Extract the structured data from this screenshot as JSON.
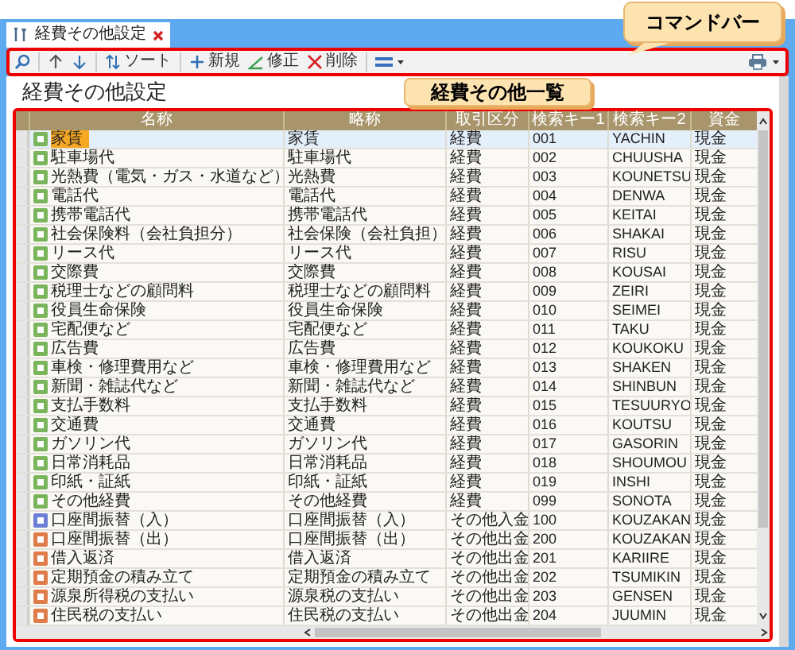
{
  "tab": {
    "title": "経費その他設定"
  },
  "toolbar": {
    "sort": "ソート",
    "new": "新規",
    "edit": "修正",
    "delete": "削除"
  },
  "page_title": "経費その他設定",
  "callouts": [
    {
      "text": "コマンドバー"
    },
    {
      "text": "経費その他一覧"
    }
  ],
  "table": {
    "columns": [
      "名称",
      "略称",
      "取引区分",
      "検索キー1",
      "検索キー2",
      "資金"
    ],
    "rows": [
      {
        "kind": "expense",
        "selected": true,
        "cells": [
          "家賃",
          "家賃",
          "経費",
          "001",
          "YACHIN",
          "現金"
        ]
      },
      {
        "kind": "expense",
        "selected": false,
        "cells": [
          "駐車場代",
          "駐車場代",
          "経費",
          "002",
          "CHUUSHA",
          "現金"
        ]
      },
      {
        "kind": "expense",
        "selected": false,
        "cells": [
          "光熱費（電気・ガス・水道など）",
          "光熱費",
          "経費",
          "003",
          "KOUNETSU",
          "現金"
        ]
      },
      {
        "kind": "expense",
        "selected": false,
        "cells": [
          "電話代",
          "電話代",
          "経費",
          "004",
          "DENWA",
          "現金"
        ]
      },
      {
        "kind": "expense",
        "selected": false,
        "cells": [
          "携帯電話代",
          "携帯電話代",
          "経費",
          "005",
          "KEITAI",
          "現金"
        ]
      },
      {
        "kind": "expense",
        "selected": false,
        "cells": [
          "社会保険料（会社負担分）",
          "社会保険（会社負担）",
          "経費",
          "006",
          "SHAKAI",
          "現金"
        ]
      },
      {
        "kind": "expense",
        "selected": false,
        "cells": [
          "リース代",
          "リース代",
          "経費",
          "007",
          "RISU",
          "現金"
        ]
      },
      {
        "kind": "expense",
        "selected": false,
        "cells": [
          "交際費",
          "交際費",
          "経費",
          "008",
          "KOUSAI",
          "現金"
        ]
      },
      {
        "kind": "expense",
        "selected": false,
        "cells": [
          "税理士などの顧問料",
          "税理士などの顧問料",
          "経費",
          "009",
          "ZEIRI",
          "現金"
        ]
      },
      {
        "kind": "expense",
        "selected": false,
        "cells": [
          "役員生命保険",
          "役員生命保険",
          "経費",
          "010",
          "SEIMEI",
          "現金"
        ]
      },
      {
        "kind": "expense",
        "selected": false,
        "cells": [
          "宅配便など",
          "宅配便など",
          "経費",
          "011",
          "TAKU",
          "現金"
        ]
      },
      {
        "kind": "expense",
        "selected": false,
        "cells": [
          "広告費",
          "広告費",
          "経費",
          "012",
          "KOUKOKU",
          "現金"
        ]
      },
      {
        "kind": "expense",
        "selected": false,
        "cells": [
          "車検・修理費用など",
          "車検・修理費用など",
          "経費",
          "013",
          "SHAKEN",
          "現金"
        ]
      },
      {
        "kind": "expense",
        "selected": false,
        "cells": [
          "新聞・雑誌代など",
          "新聞・雑誌代など",
          "経費",
          "014",
          "SHINBUN",
          "現金"
        ]
      },
      {
        "kind": "expense",
        "selected": false,
        "cells": [
          "支払手数料",
          "支払手数料",
          "経費",
          "015",
          "TESUURYO",
          "現金"
        ]
      },
      {
        "kind": "expense",
        "selected": false,
        "cells": [
          "交通費",
          "交通費",
          "経費",
          "016",
          "KOUTSU",
          "現金"
        ]
      },
      {
        "kind": "expense",
        "selected": false,
        "cells": [
          "ガソリン代",
          "ガソリン代",
          "経費",
          "017",
          "GASORIN",
          "現金"
        ]
      },
      {
        "kind": "expense",
        "selected": false,
        "cells": [
          "日常消耗品",
          "日常消耗品",
          "経費",
          "018",
          "SHOUMOU",
          "現金"
        ]
      },
      {
        "kind": "expense",
        "selected": false,
        "cells": [
          "印紙・証紙",
          "印紙・証紙",
          "経費",
          "019",
          "INSHI",
          "現金"
        ]
      },
      {
        "kind": "expense",
        "selected": false,
        "cells": [
          "その他経費",
          "その他経費",
          "経費",
          "099",
          "SONOTA",
          "現金"
        ]
      },
      {
        "kind": "income",
        "selected": false,
        "cells": [
          "口座間振替（入）",
          "口座間振替（入）",
          "その他入金",
          "100",
          "KOUZAKAN",
          "現金"
        ]
      },
      {
        "kind": "payment",
        "selected": false,
        "cells": [
          "口座間振替（出）",
          "口座間振替（出）",
          "その他出金",
          "200",
          "KOUZAKAN",
          "現金"
        ]
      },
      {
        "kind": "payment",
        "selected": false,
        "cells": [
          "借入返済",
          "借入返済",
          "その他出金",
          "201",
          "KARIIRE",
          "現金"
        ]
      },
      {
        "kind": "payment",
        "selected": false,
        "cells": [
          "定期預金の積み立て",
          "定期預金の積み立て",
          "その他出金",
          "202",
          "TSUMIKIN",
          "現金"
        ]
      },
      {
        "kind": "payment",
        "selected": false,
        "cells": [
          "源泉所得税の支払い",
          "源泉税の支払い",
          "その他出金",
          "203",
          "GENSEN",
          "現金"
        ]
      },
      {
        "kind": "payment",
        "selected": false,
        "cells": [
          "住民税の支払い",
          "住民税の支払い",
          "その他出金",
          "204",
          "JUUMIN",
          "現金"
        ]
      }
    ]
  }
}
